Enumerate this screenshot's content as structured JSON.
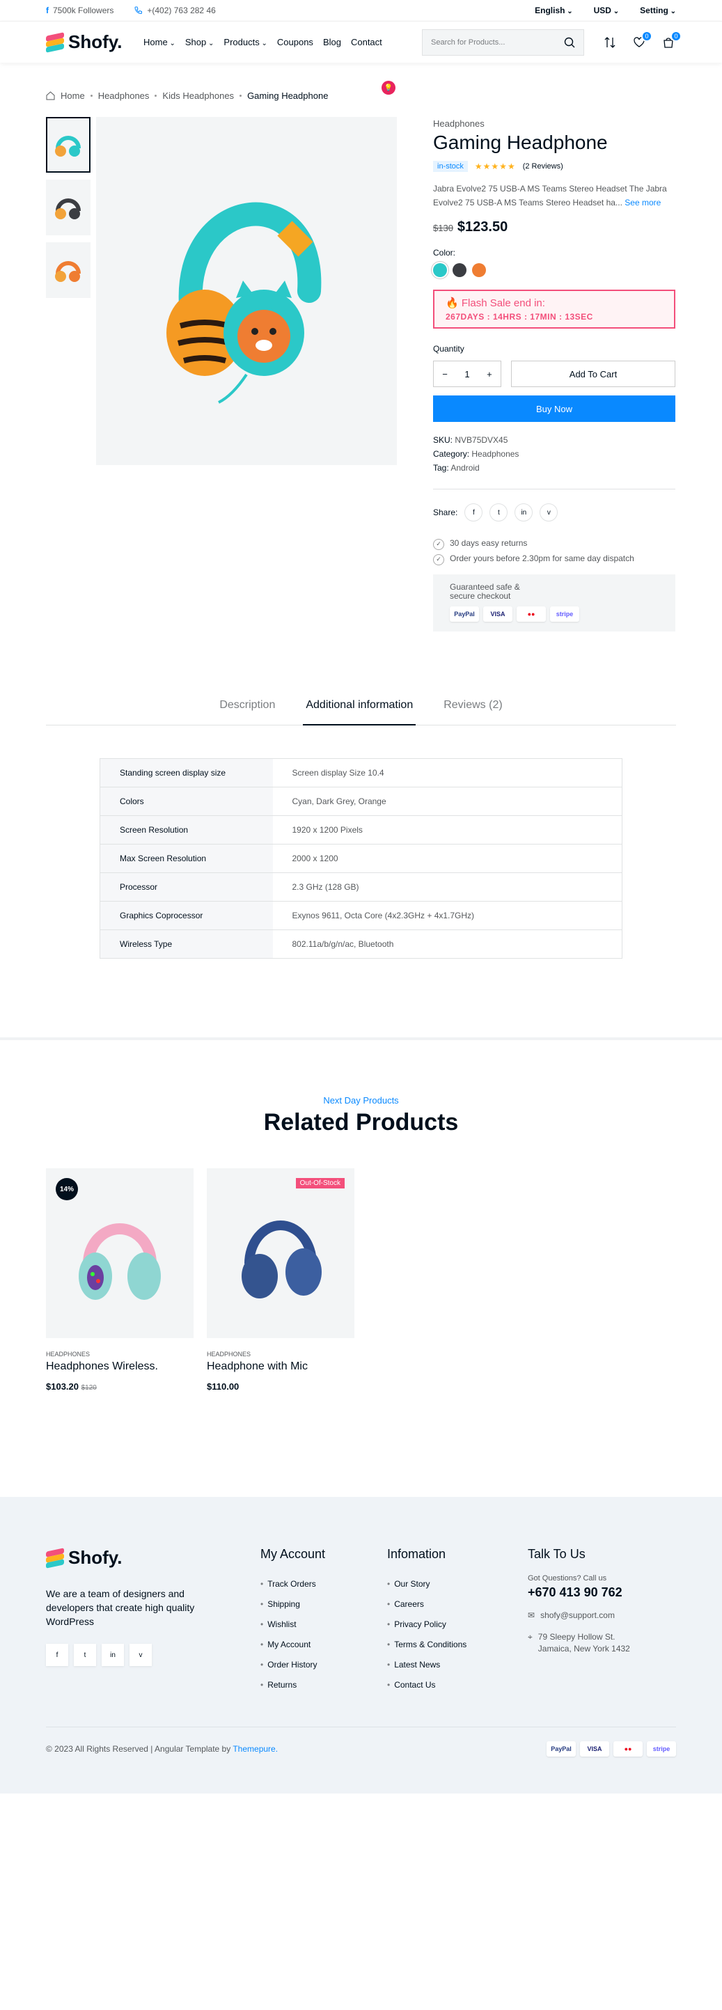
{
  "topbar": {
    "followers": "7500k Followers",
    "phone": "+(402) 763 282 46",
    "language": "English",
    "currency": "USD",
    "setting": "Setting"
  },
  "header": {
    "brand": "Shofy.",
    "nav": [
      "Home",
      "Shop",
      "Products",
      "Coupons",
      "Blog",
      "Contact"
    ],
    "search_placeholder": "Search for Products...",
    "wishlist_count": "0",
    "cart_count": "0"
  },
  "breadcrumb": [
    "Home",
    "Headphones",
    "Kids Headphones",
    "Gaming Headphone"
  ],
  "product": {
    "category": "Headphones",
    "title": "Gaming Headphone",
    "stock": "in-stock",
    "rating": "★★★★★",
    "reviews": "(2 Reviews)",
    "description": "Jabra Evolve2 75 USB-A MS Teams Stereo Headset The Jabra Evolve2 75 USB-A MS Teams Stereo Headset ha...",
    "see_more": "See more",
    "old_price": "$130",
    "price": "$123.50",
    "color_label": "Color:",
    "colors": [
      "#2bc8c8",
      "#3b3d42",
      "#ef7d32"
    ],
    "flash_title": "Flash Sale end in:",
    "countdown": [
      "267DAYS",
      "14HRS",
      "17MIN",
      "13SEC"
    ],
    "quantity_label": "Quantity",
    "quantity": "1",
    "add_to_cart": "Add To Cart",
    "buy_now": "Buy Now",
    "sku_label": "SKU:",
    "sku": "NVB75DVX45",
    "category_label": "Category:",
    "category_value": "Headphones",
    "tag_label": "Tag:",
    "tag": "Android",
    "share_label": "Share:",
    "guarantees": [
      "30 days easy returns",
      "Order yours before 2.30pm for same day dispatch"
    ],
    "secure_title": "Guaranteed safe & secure checkout"
  },
  "payments": [
    "PayPal",
    "VISA",
    "●●",
    "stripe"
  ],
  "tabs": [
    "Description",
    "Additional information",
    "Reviews (2)"
  ],
  "specs": [
    {
      "k": "Standing screen display size",
      "v": "Screen display Size 10.4"
    },
    {
      "k": "Colors",
      "v": "Cyan, Dark Grey, Orange"
    },
    {
      "k": "Screen Resolution",
      "v": "1920 x 1200 Pixels"
    },
    {
      "k": "Max Screen Resolution",
      "v": "2000 x 1200"
    },
    {
      "k": "Processor",
      "v": "2.3 GHz (128 GB)"
    },
    {
      "k": "Graphics Coprocessor",
      "v": "Exynos 9611, Octa Core (4x2.3GHz + 4x1.7GHz)"
    },
    {
      "k": "Wireless Type",
      "v": "802.11a/b/g/n/ac, Bluetooth"
    }
  ],
  "related": {
    "subtitle": "Next Day Products",
    "title": "Related Products",
    "items": [
      {
        "cat": "HEADPHONES",
        "name": "Headphones Wireless.",
        "price": "$103.20",
        "old": "$120",
        "badge": "14%"
      },
      {
        "cat": "HEADPHONES",
        "name": "Headphone with Mic",
        "price": "$110.00",
        "badge": "Out-Of-Stock"
      }
    ]
  },
  "footer": {
    "brand": "Shofy.",
    "about": "We are a team of designers and developers that create high quality WordPress",
    "social": [
      "f",
      "t",
      "in",
      "v"
    ],
    "account_title": "My Account",
    "account": [
      "Track Orders",
      "Shipping",
      "Wishlist",
      "My Account",
      "Order History",
      "Returns"
    ],
    "info_title": "Infomation",
    "info": [
      "Our Story",
      "Careers",
      "Privacy Policy",
      "Terms & Conditions",
      "Latest News",
      "Contact Us"
    ],
    "talk_title": "Talk To Us",
    "question": "Got Questions? Call us",
    "phone": "+670 413 90 762",
    "email": "shofy@support.com",
    "address": "79 Sleepy Hollow St. Jamaica, New York 1432",
    "copyright": "© 2023 All Rights Reserved | Angular Template by",
    "themepure": "Themepure."
  }
}
